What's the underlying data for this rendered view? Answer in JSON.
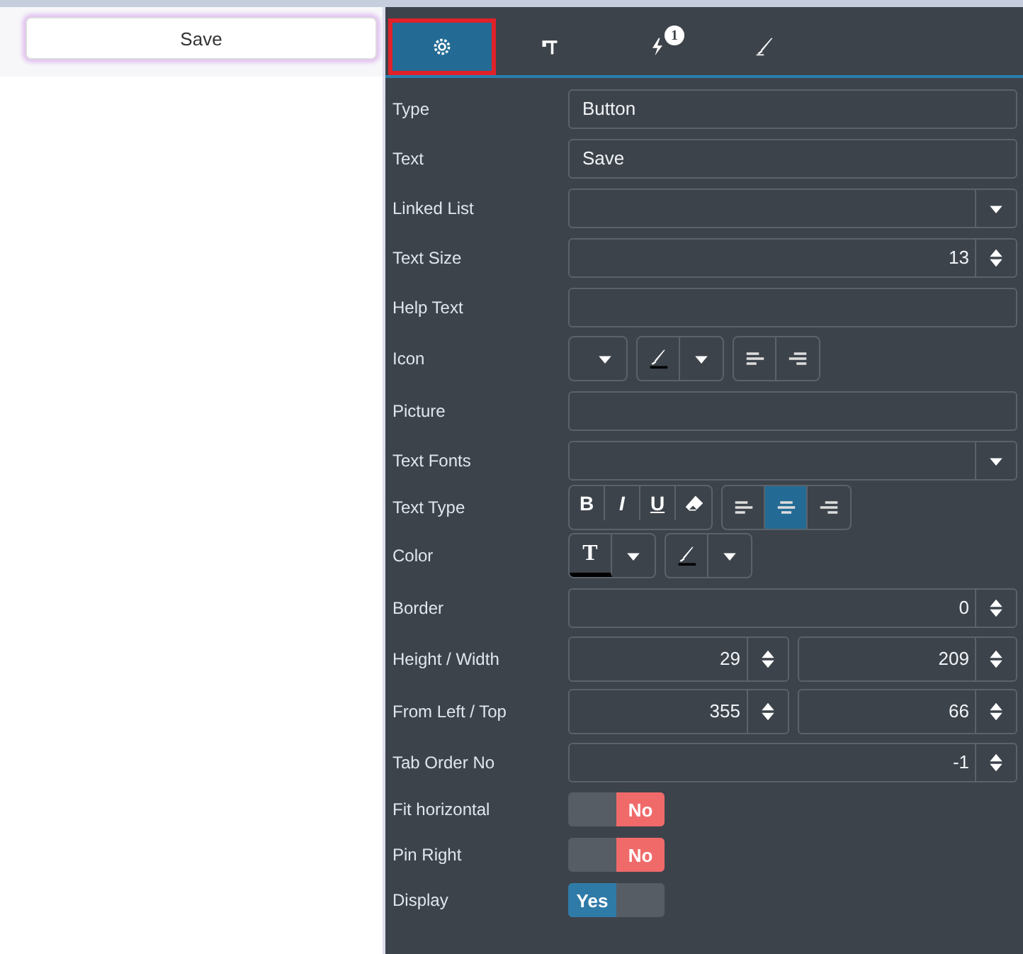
{
  "canvas": {
    "button": {
      "label": "Save"
    }
  },
  "tabs": [
    {
      "kind": "settings",
      "selected": true
    },
    {
      "kind": "layout",
      "selected": false
    },
    {
      "kind": "events",
      "selected": false,
      "badge": "1"
    },
    {
      "kind": "style",
      "selected": false
    }
  ],
  "properties": [
    {
      "kind": "text",
      "label": "Type",
      "value": "Button"
    },
    {
      "kind": "text",
      "label": "Text",
      "value": "Save"
    },
    {
      "kind": "select",
      "label": "Linked List"
    },
    {
      "kind": "number",
      "label": "Text Size",
      "value": "13"
    },
    {
      "kind": "text",
      "label": "Help Text"
    },
    {
      "kind": "icon",
      "label": "Icon",
      "align": [
        {
          "kind": "left",
          "selected": false
        },
        {
          "kind": "right",
          "selected": false
        }
      ]
    },
    {
      "kind": "text",
      "label": "Picture"
    },
    {
      "kind": "select",
      "label": "Text Fonts"
    },
    {
      "kind": "texttype",
      "label": "Text Type",
      "format": [
        {
          "kind": "bold",
          "label": "B",
          "selected": false
        },
        {
          "kind": "italic",
          "label": "I",
          "selected": false
        },
        {
          "kind": "underline",
          "label": "U",
          "selected": false
        },
        {
          "kind": "clear",
          "selected": false
        }
      ],
      "align": [
        {
          "kind": "left",
          "selected": false
        },
        {
          "kind": "center",
          "selected": true
        },
        {
          "kind": "right",
          "selected": false
        }
      ]
    },
    {
      "kind": "color",
      "label": "Color",
      "text_glyph": "T"
    },
    {
      "kind": "number",
      "label": "Border",
      "value": "0"
    },
    {
      "kind": "pair",
      "label": "Height / Width",
      "values": [
        "29",
        "209"
      ]
    },
    {
      "kind": "pair",
      "label": "From Left / Top",
      "values": [
        "355",
        "66"
      ]
    },
    {
      "kind": "number",
      "label": "Tab Order No",
      "value": "-1"
    },
    {
      "kind": "toggle",
      "label": "Fit horizontal",
      "on": false,
      "value": "No"
    },
    {
      "kind": "toggle",
      "label": "Pin Right",
      "on": false,
      "value": "No"
    },
    {
      "kind": "toggle",
      "label": "Display",
      "on": true,
      "value": "Yes"
    }
  ]
}
